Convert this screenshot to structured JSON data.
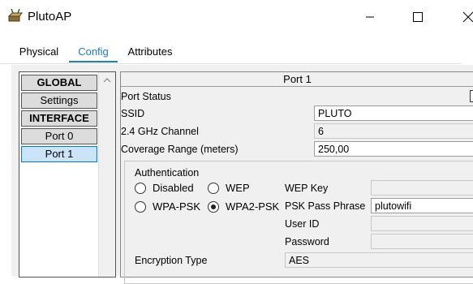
{
  "window": {
    "title": "PlutoAP"
  },
  "tabs": [
    {
      "label": "Physical"
    },
    {
      "label": "Config"
    },
    {
      "label": "Attributes"
    }
  ],
  "sidebar": {
    "items": [
      {
        "label": "GLOBAL"
      },
      {
        "label": "Settings"
      },
      {
        "label": "INTERFACE"
      },
      {
        "label": "Port 0"
      },
      {
        "label": "Port 1"
      }
    ]
  },
  "panel": {
    "title": "Port 1",
    "port_status_label": "Port Status",
    "ssid_label": "SSID",
    "ssid_value": "PLUTO",
    "channel_label": "2.4 GHz Channel",
    "channel_value": "6",
    "coverage_label": "Coverage Range (meters)",
    "coverage_value": "250,00"
  },
  "auth": {
    "title": "Authentication",
    "options": {
      "disabled": "Disabled",
      "wep": "WEP",
      "wpa_psk": "WPA-PSK",
      "wpa2_psk": "WPA2-PSK"
    },
    "selected": "WPA2-PSK",
    "wep_key_label": "WEP Key",
    "wep_key_value": "",
    "psk_label": "PSK Pass Phrase",
    "psk_value": "plutowifi",
    "user_id_label": "User ID",
    "user_id_value": "",
    "password_label": "Password",
    "password_value": "",
    "encryption_label": "Encryption Type",
    "encryption_value": "AES"
  }
}
